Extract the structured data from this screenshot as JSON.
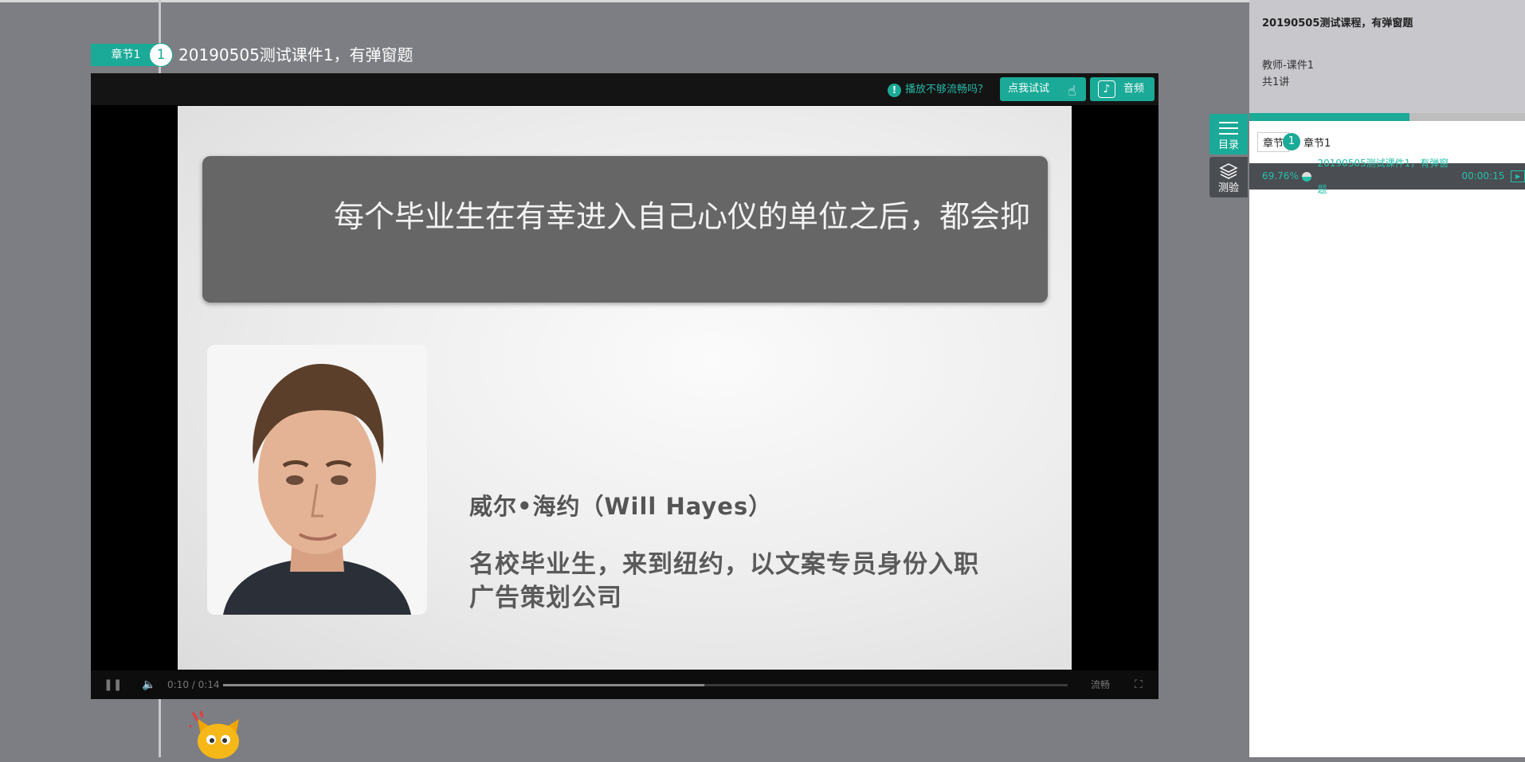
{
  "chapter": {
    "tag": "章节1",
    "number": "1",
    "title": "20190505测试课件1，有弹窗题"
  },
  "player": {
    "hint": "播放不够流畅吗？",
    "try_button": "点我试试",
    "audio_button": "音频",
    "slide": {
      "headline": "每个毕业生在有幸进入自己心仪的单位之后，都会抑",
      "name": "威尔•海约（Will Hayes）",
      "desc_line1": "名校毕业生，来到纽约，以文案专员身份入职",
      "desc_line2": "广告策划公司"
    },
    "controls": {
      "time": "0:10 / 0:14",
      "quality": "流畅",
      "progress": 0.57
    }
  },
  "panel": {
    "course_title": "20190505测试课程，有弹窗题",
    "teacher": "教师-课件1",
    "lesson_count": "共1讲",
    "progress": 0.58,
    "section": {
      "chip": "章节",
      "number": "1",
      "name": "章节1"
    },
    "lesson": {
      "percent": "69.76%",
      "title": "20190505测试课件1，有弹窗题",
      "duration": "00:00:15"
    }
  },
  "tabs": {
    "menu": "目录",
    "quiz": "测验"
  },
  "colors": {
    "accent": "#1aaa97",
    "background": "#7d7e83",
    "dark": "#4a4d52"
  }
}
